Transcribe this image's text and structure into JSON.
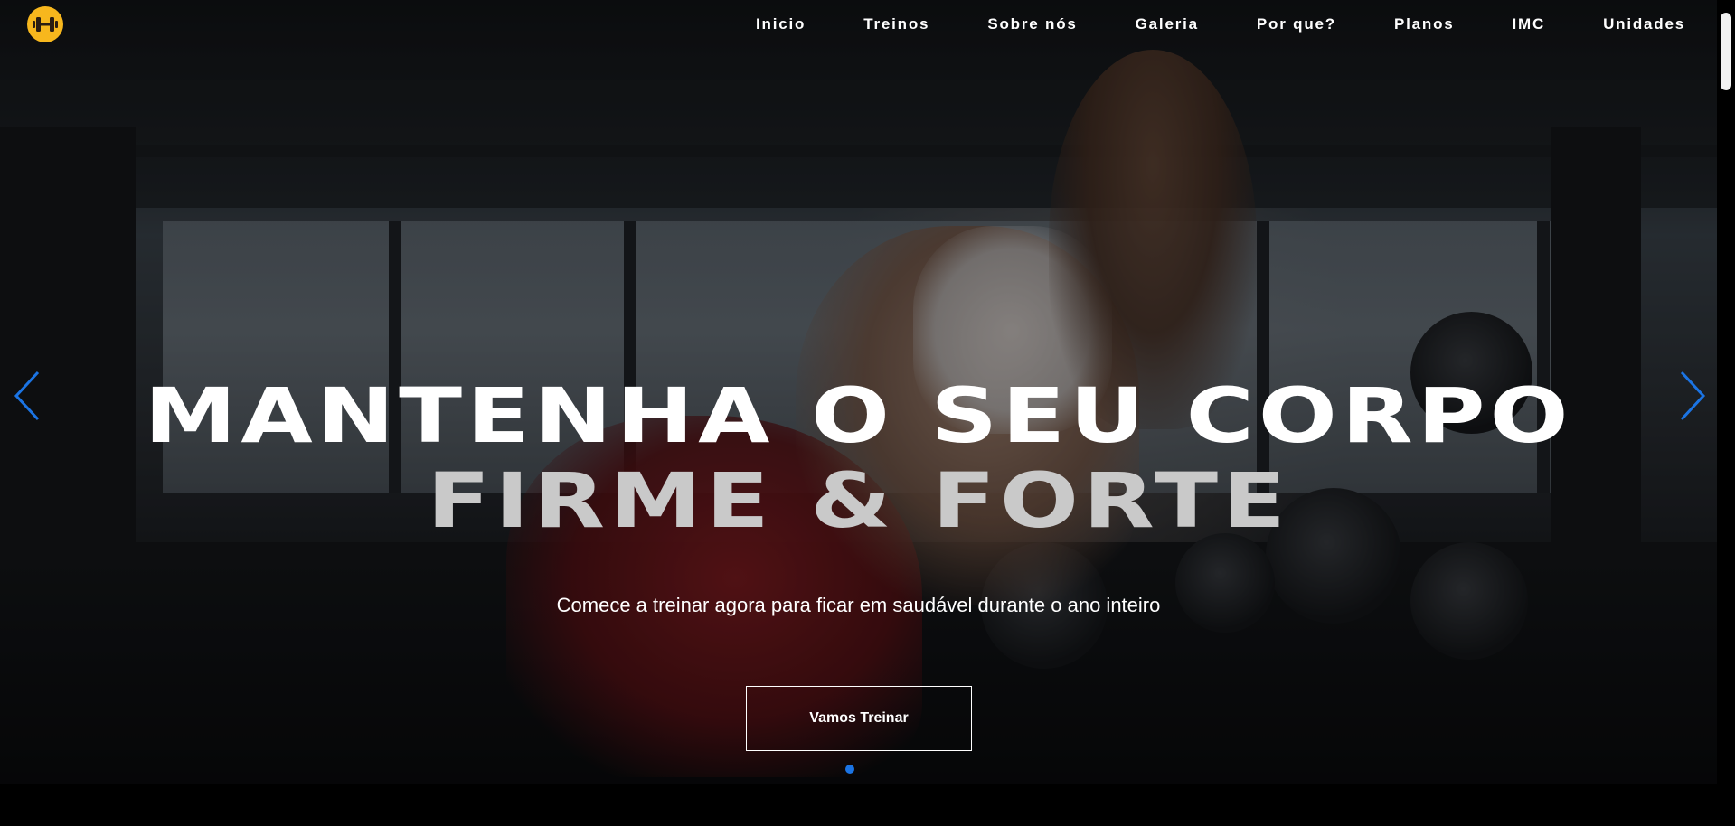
{
  "nav": {
    "logo_icon": "dumbbell-icon",
    "links": [
      "Inicio",
      "Treinos",
      "Sobre nós",
      "Galeria",
      "Por que?",
      "Planos",
      "IMC",
      "Unidades"
    ]
  },
  "hero": {
    "headline_line1": "MANTENHA O SEU CORPO",
    "headline_line2": "FIRME & FORTE",
    "subtitle": "Comece a treinar agora para ficar em saudável durante o ano inteiro",
    "cta_label": "Vamos Treinar",
    "prev_icon": "chevron-left-icon",
    "next_icon": "chevron-right-icon",
    "slide_count": 1,
    "active_slide": 1
  },
  "colors": {
    "logo": "#f7b71d",
    "accent": "#1b74e4",
    "headline_line1": "#ffffff",
    "headline_line2": "#c9c9c9"
  }
}
